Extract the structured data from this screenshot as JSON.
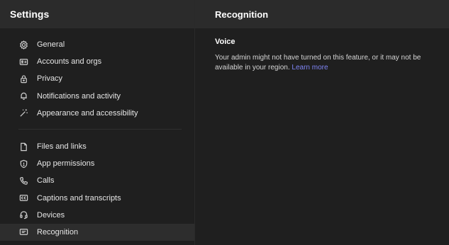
{
  "sidebar": {
    "title": "Settings",
    "group1": [
      {
        "label": "General",
        "icon": "gear-icon"
      },
      {
        "label": "Accounts and orgs",
        "icon": "id-card-icon"
      },
      {
        "label": "Privacy",
        "icon": "lock-icon"
      },
      {
        "label": "Notifications and activity",
        "icon": "bell-icon"
      },
      {
        "label": "Appearance and accessibility",
        "icon": "magic-wand-icon"
      }
    ],
    "group2": [
      {
        "label": "Files and links",
        "icon": "file-icon"
      },
      {
        "label": "App permissions",
        "icon": "shield-icon"
      },
      {
        "label": "Calls",
        "icon": "phone-icon"
      },
      {
        "label": "Captions and transcripts",
        "icon": "captions-icon"
      },
      {
        "label": "Devices",
        "icon": "headset-icon"
      },
      {
        "label": "Recognition",
        "icon": "recognition-icon"
      }
    ],
    "active": "Recognition"
  },
  "main": {
    "title": "Recognition",
    "section_title": "Voice",
    "body_text": "Your admin might not have turned on this feature, or it may not be available in your region.",
    "learn_more": "Learn more"
  },
  "colors": {
    "background": "#1f1f1f",
    "header": "#2b2b2b",
    "link": "#7f85f5",
    "active_item": "#2d2d2d"
  }
}
